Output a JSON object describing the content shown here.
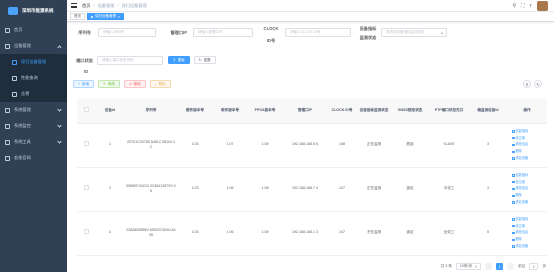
{
  "app": {
    "title": "深圳市能源系统"
  },
  "sidebar": {
    "items": [
      {
        "label": "首页",
        "icon": "home-icon"
      },
      {
        "label": "设备管理",
        "icon": "monitor-icon",
        "open": true,
        "children": [
          {
            "label": "保扫设备管理",
            "icon": "device-icon",
            "active": true
          },
          {
            "label": "性能查询",
            "icon": "chart-icon"
          },
          {
            "label": "告警",
            "icon": "bell-icon"
          }
        ]
      },
      {
        "label": "系统管理",
        "icon": "settings-icon"
      },
      {
        "label": "系统监控",
        "icon": "eye-icon"
      },
      {
        "label": "系统工具",
        "icon": "tool-icon"
      },
      {
        "label": "若依官网",
        "icon": "send-icon"
      }
    ]
  },
  "navbar": {
    "breadcrumb": [
      "首页",
      "设备管理",
      "保扫设备管理"
    ],
    "sep": "/",
    "icons": [
      "search-icon",
      "fullscreen-icon",
      "font-size-icon"
    ]
  },
  "tags": [
    {
      "label": "首页"
    },
    {
      "label": "保扫设备管理",
      "active": true
    }
  ],
  "form": {
    "serial": {
      "label": "序列号",
      "placeholder": "请输入序列号"
    },
    "mgmt_ip": {
      "label": "管理口IP",
      "placeholder": "请输入管理口IP"
    },
    "clock": {
      "label": "CLOCK",
      "label2": "ID号",
      "placeholder": "请输入CLOCK ID号"
    },
    "status": {
      "label": "设备指标",
      "label2": "监测状态",
      "placeholder": "请选择设备指标监测状态"
    },
    "port": {
      "label": "端口状态",
      "placeholder": "请输入端口状态号码"
    },
    "id": {
      "label": "ID"
    },
    "search_btn": "搜索",
    "reset_btn": "重置"
  },
  "toolbar": {
    "add": "新增",
    "edit": "修改",
    "delete": "删除",
    "export": "导出"
  },
  "table": {
    "headers": [
      "设备Id",
      "序列号",
      "硬件版本号",
      "软件版本号",
      "FPGA版本号",
      "管理口IP",
      "CLOCK ID号",
      "设备指标监测状态",
      "GNSS锁定状态",
      "PTP端口状态先口",
      "端监测设备Id",
      "操作"
    ],
    "rows": [
      {
        "id": "1",
        "serial": "20T01C20755 5481C76D04 3C",
        "hw": "1.03",
        "sw": "1.07",
        "fpga": "1.08",
        "ip": "192.168.188.5 6",
        "clock": "158",
        "monitor": "正在监测",
        "gnss": "跌锁",
        "ptp": "SLAVE",
        "devid": "3"
      },
      {
        "id": "2",
        "serial": "3985EF43C02 023041357S0 V5",
        "hw": "1.03",
        "sw": "1.06",
        "fpga": "1.08",
        "ip": "192.168.188.7 4",
        "clock": "147",
        "monitor": "正在监测",
        "gnss": "锁定",
        "ptp": "半双工",
        "devid": "3"
      },
      {
        "id": "3",
        "serial": "230A839855V M53/G76040 A135",
        "hw": "1.03",
        "sw": "1.06",
        "fpga": "1.08",
        "ip": "192.168.188.1 3",
        "clock": "147",
        "monitor": "不在监测",
        "gnss": "锁定",
        "ptp": "全双工",
        "devid": "5"
      }
    ],
    "ops": [
      "性能指标",
      "告位置",
      "修改信息",
      "删除",
      "重启设备"
    ]
  },
  "pagination": {
    "total": "共 3 条",
    "size": "10条/页",
    "page": "1",
    "goto": "前往",
    "goto_page": "1",
    "page_suffix": "页"
  },
  "colors": {
    "sidebar": "#304156",
    "accent": "#409eff"
  }
}
